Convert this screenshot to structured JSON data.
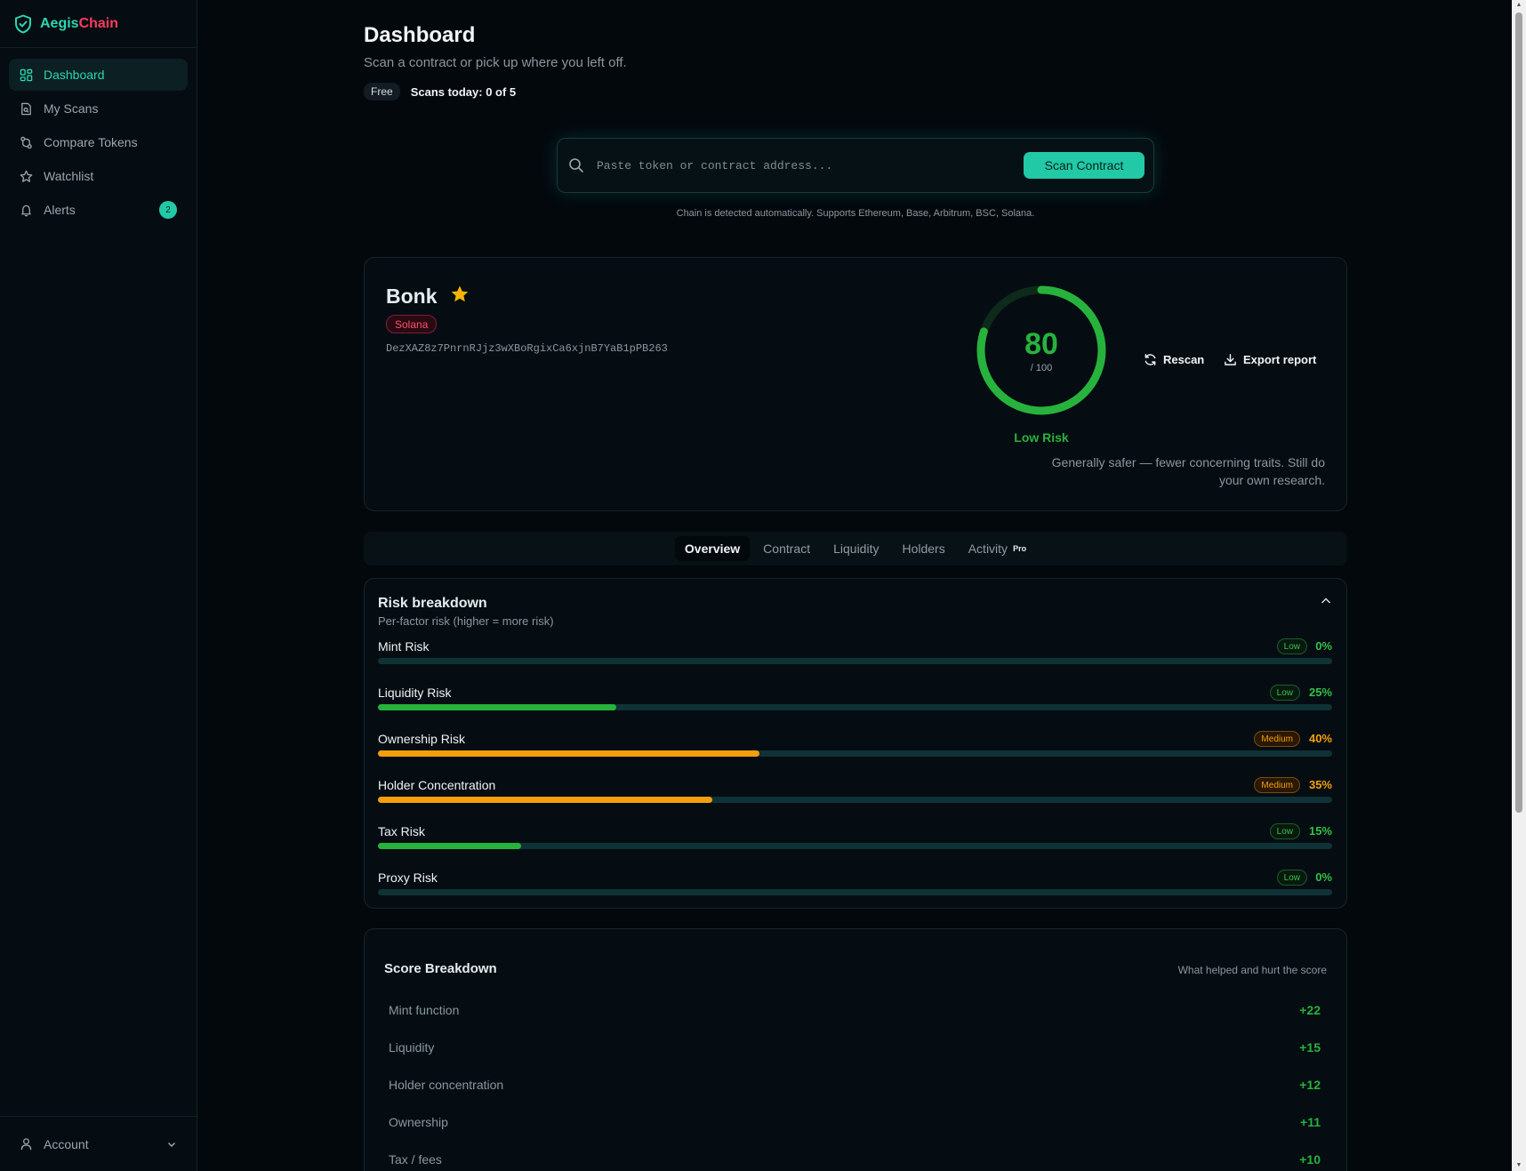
{
  "brand": {
    "name_part1": "Aegis",
    "name_part2": "Chain"
  },
  "sidebar": {
    "items": [
      {
        "label": "Dashboard",
        "icon": "grid-icon",
        "active": true
      },
      {
        "label": "My Scans",
        "icon": "file-search-icon"
      },
      {
        "label": "Compare Tokens",
        "icon": "compare-icon"
      },
      {
        "label": "Watchlist",
        "icon": "star-icon"
      },
      {
        "label": "Alerts",
        "icon": "bell-icon",
        "badge": "2"
      }
    ],
    "account_label": "Account"
  },
  "header": {
    "title": "Dashboard",
    "subtitle": "Scan a contract or pick up where you left off.",
    "plan": "Free",
    "scans_today": "Scans today: 0 of 5"
  },
  "search": {
    "placeholder": "Paste token or contract address...",
    "value": "",
    "button": "Scan Contract",
    "note": "Chain is detected automatically. Supports Ethereum, Base, Arbitrum, BSC, Solana."
  },
  "token": {
    "name": "Bonk",
    "chain": "Solana",
    "address": "DezXAZ8z7PnrnRJjz3wXBoRgixCa6xjnB7YaB1pPB263",
    "score": 80,
    "score_max_label": "/ 100",
    "score_fraction": 0.8,
    "risk_level": "Low Risk",
    "risk_description": "Generally safer — fewer concerning traits. Still do your own research.",
    "rescan_label": "Rescan",
    "export_label": "Export report",
    "colors": {
      "score": "#27b23c",
      "star": "#f5b400"
    }
  },
  "tabs": [
    {
      "label": "Overview",
      "active": true
    },
    {
      "label": "Contract"
    },
    {
      "label": "Liquidity"
    },
    {
      "label": "Holders"
    },
    {
      "label": "Activity",
      "badge": "Pro"
    }
  ],
  "risk_breakdown": {
    "title": "Risk breakdown",
    "subtitle": "Per-factor risk (higher = more risk)",
    "items": [
      {
        "label": "Mint Risk",
        "level": "Low",
        "pct_label": "0%",
        "value": 0
      },
      {
        "label": "Liquidity Risk",
        "level": "Low",
        "pct_label": "25%",
        "value": 25
      },
      {
        "label": "Ownership Risk",
        "level": "Medium",
        "pct_label": "40%",
        "value": 40
      },
      {
        "label": "Holder Concentration",
        "level": "Medium",
        "pct_label": "35%",
        "value": 35
      },
      {
        "label": "Tax Risk",
        "level": "Low",
        "pct_label": "15%",
        "value": 15
      },
      {
        "label": "Proxy Risk",
        "level": "Low",
        "pct_label": "0%",
        "value": 0
      }
    ]
  },
  "score_breakdown": {
    "title": "Score Breakdown",
    "hint": "What helped and hurt the score",
    "items": [
      {
        "label": "Mint function",
        "value": "+22"
      },
      {
        "label": "Liquidity",
        "value": "+15"
      },
      {
        "label": "Holder concentration",
        "value": "+12"
      },
      {
        "label": "Ownership",
        "value": "+11"
      },
      {
        "label": "Tax / fees",
        "value": "+10"
      }
    ]
  }
}
